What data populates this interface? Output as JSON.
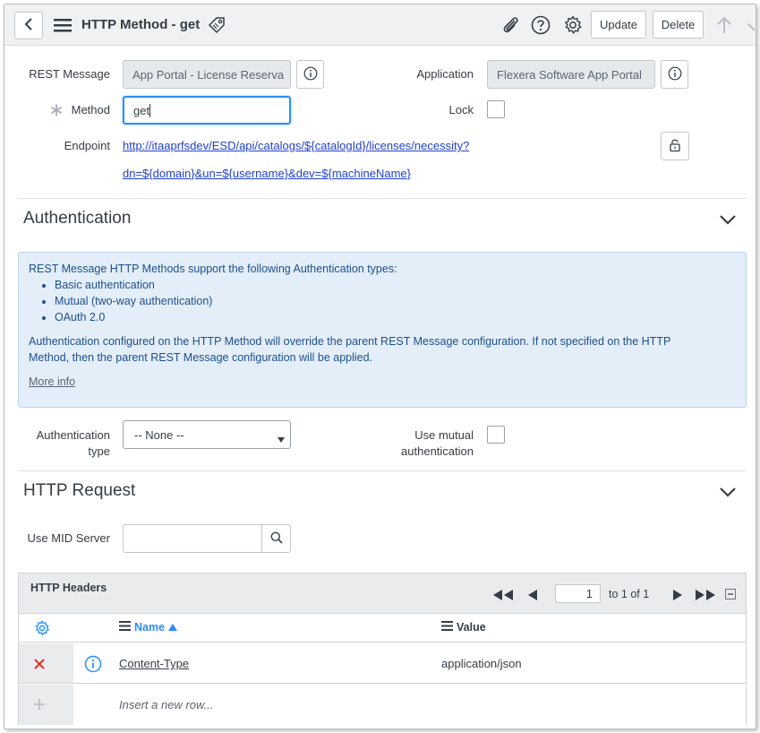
{
  "header": {
    "title": "HTTP Method - get",
    "update_label": "Update",
    "delete_label": "Delete"
  },
  "form": {
    "rest_message_label": "REST Message",
    "rest_message_value": "App Portal - License Reserva",
    "application_label": "Application",
    "application_value": "Flexera Software App Portal",
    "method_label": "Method",
    "method_value": "get",
    "lock_label": "Lock",
    "endpoint_label": "Endpoint",
    "endpoint_line1": "http://itaaprfsdev/ESD/api/catalogs/${catalogId}/licenses/necessity?",
    "endpoint_line2": "dn=${domain}&un=${username}&dev=${machineName}"
  },
  "authentication": {
    "section_title": "Authentication",
    "info_intro": "REST Message HTTP Methods support the following Authentication types:",
    "info_items": [
      "Basic authentication",
      "Mutual (two-way authentication)",
      "OAuth 2.0"
    ],
    "info_line2a": "Authentication configured on the HTTP Method will override the parent REST Message configuration. If not specified on the HTTP",
    "info_line2b": "Method, then the parent REST Message configuration will be applied.",
    "more_info": "More info",
    "auth_type_label_1": "Authentication",
    "auth_type_label_2": "type",
    "auth_type_value": "-- None --",
    "mutual_label_1": "Use mutual",
    "mutual_label_2": "authentication"
  },
  "http_request": {
    "section_title": "HTTP Request",
    "mid_label": "Use MID Server",
    "mid_value": ""
  },
  "headers_table": {
    "title": "HTTP Headers",
    "page_value": "1",
    "page_of": "to 1 of 1",
    "col_name": "Name",
    "col_value": "Value",
    "rows": [
      {
        "name": "Content-Type",
        "value": "application/json"
      }
    ],
    "insert_placeholder": "Insert a new row..."
  },
  "colors": {
    "accent": "#278efc",
    "delete_red": "#e32c2c",
    "info_bg": "#e3eef8",
    "info_text": "#1e4f8c",
    "link": "#1f3fd1"
  }
}
